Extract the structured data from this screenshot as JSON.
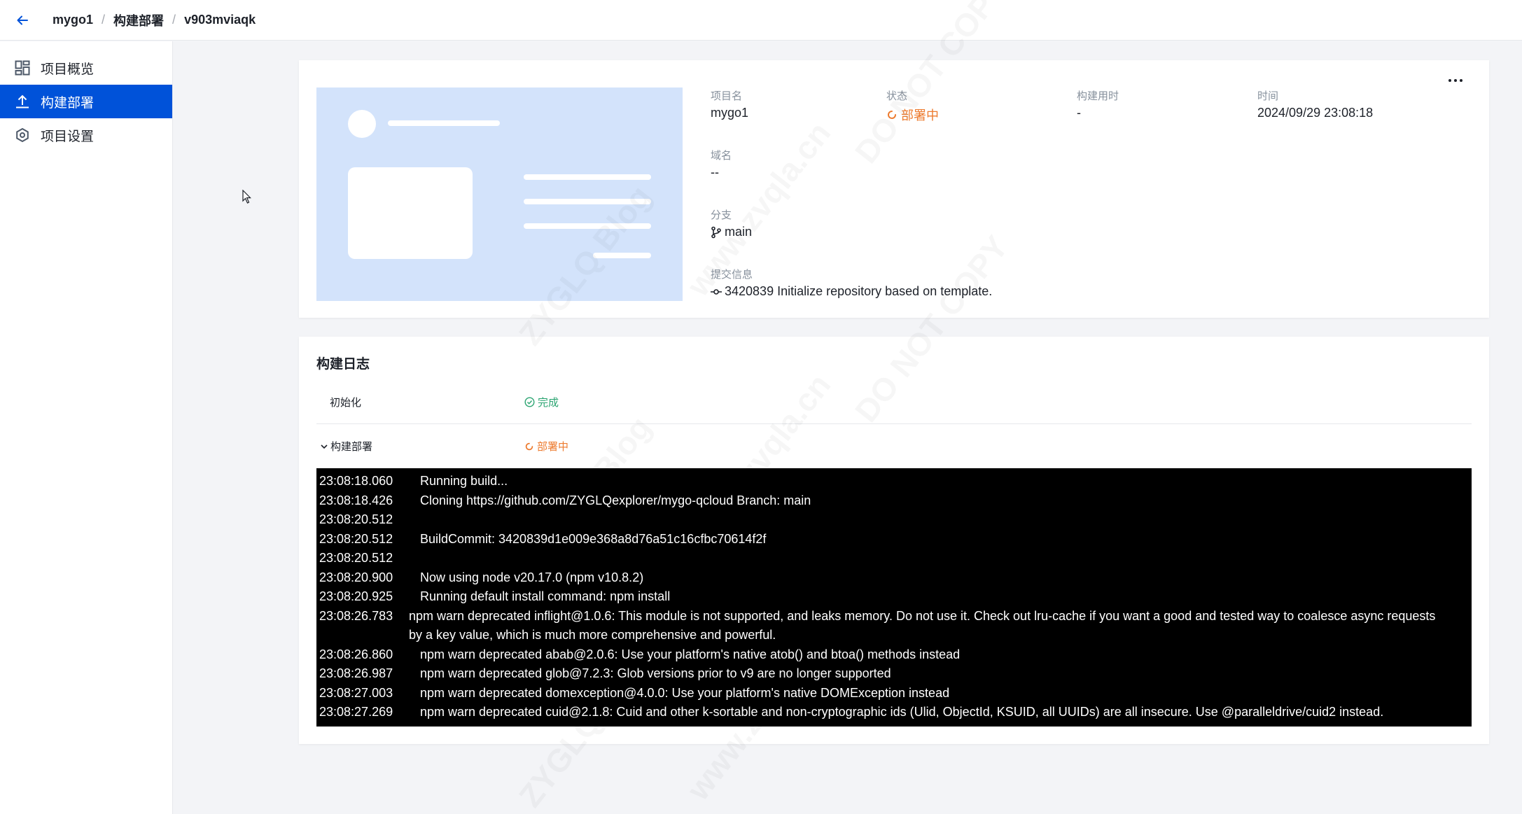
{
  "breadcrumb": {
    "project": "mygo1",
    "section": "构建部署",
    "deployment": "v903mviaqk"
  },
  "sidebar": {
    "items": [
      {
        "label": "项目概览",
        "icon": "dashboard-icon",
        "active": false
      },
      {
        "label": "构建部署",
        "icon": "upload-icon",
        "active": true
      },
      {
        "label": "项目设置",
        "icon": "settings-icon",
        "active": false
      }
    ]
  },
  "deployment": {
    "project_name_label": "项目名",
    "project_name": "mygo1",
    "status_label": "状态",
    "status": "部署中",
    "duration_label": "构建用时",
    "duration": "-",
    "time_label": "时间",
    "time": "2024/09/29 23:08:18",
    "domain_label": "域名",
    "domain": "--",
    "branch_label": "分支",
    "branch": "main",
    "commit_label": "提交信息",
    "commit": "3420839 Initialize repository based on template."
  },
  "build_log": {
    "title": "构建日志",
    "steps": [
      {
        "name": "初始化",
        "status": "完成"
      },
      {
        "name": "构建部署",
        "status": "部署中"
      }
    ],
    "lines": [
      {
        "time": "23:08:18.060",
        "msg": "Running build..."
      },
      {
        "time": "23:08:18.426",
        "msg": "Cloning https://github.com/ZYGLQexplorer/mygo-qcloud Branch: main"
      },
      {
        "time": "23:08:20.512",
        "msg": ""
      },
      {
        "time": "23:08:20.512",
        "msg": "BuildCommit: 3420839d1e009e368a8d76a51c16cfbc70614f2f"
      },
      {
        "time": "23:08:20.512",
        "msg": ""
      },
      {
        "time": "23:08:20.900",
        "msg": "Now using node v20.17.0 (npm v10.8.2)"
      },
      {
        "time": "23:08:20.925",
        "msg": "Running default install command: npm install"
      },
      {
        "time": "23:08:26.783",
        "msg": "npm warn deprecated inflight@1.0.6: This module is not supported, and leaks memory. Do not use it. Check out lru-cache if you want a good and tested way to coalesce async requests by a key value, which is much more comprehensive and powerful."
      },
      {
        "time": "23:08:26.860",
        "msg": "npm warn deprecated abab@2.0.6: Use your platform's native atob() and btoa() methods instead"
      },
      {
        "time": "23:08:26.987",
        "msg": "npm warn deprecated glob@7.2.3: Glob versions prior to v9 are no longer supported"
      },
      {
        "time": "23:08:27.003",
        "msg": "npm warn deprecated domexception@4.0.0: Use your platform's native DOMException instead"
      },
      {
        "time": "23:08:27.269",
        "msg": "npm warn deprecated cuid@2.1.8: Cuid and other k-sortable and non-cryptographic ids (Ulid, ObjectId, KSUID, all UUIDs) are all insecure. Use @paralleldrive/cuid2 instead."
      }
    ]
  },
  "watermark": {
    "text_a": "ZYGLQ Blog",
    "text_b": "www.zvqla.cn",
    "text_c": "DO NOT COPY"
  },
  "colors": {
    "primary": "#0052d9",
    "warning": "#ed7b2f",
    "success": "#2ba471"
  }
}
